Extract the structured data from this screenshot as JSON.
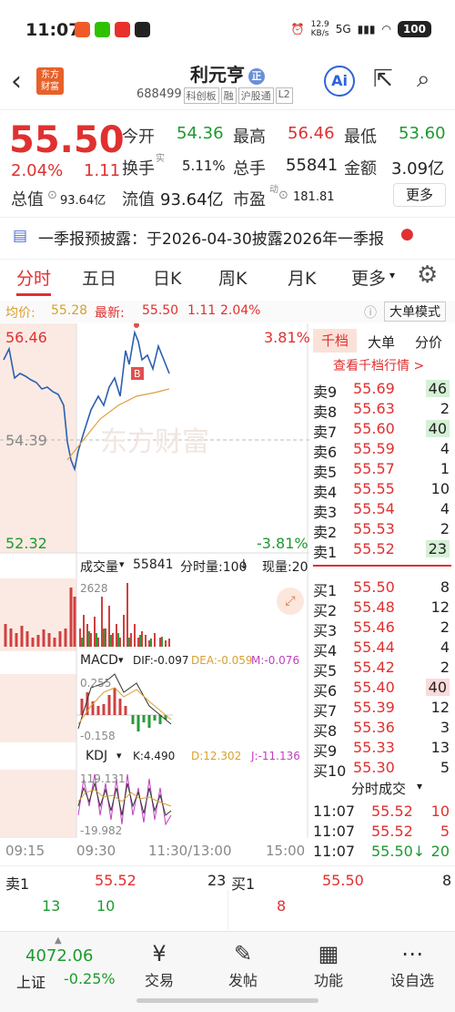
{
  "status": {
    "time": "11:07",
    "speed": "12.9\nKB/s",
    "net": "5G",
    "battery": "100"
  },
  "header": {
    "logo_line1": "东方",
    "logo_line2": "财富",
    "name": "利元亨",
    "name_badge": "正",
    "code": "688499",
    "tags": [
      "科创板",
      "融",
      "沪股通",
      "L2"
    ]
  },
  "quote": {
    "price": "55.50",
    "pct": "2.04%",
    "chg": "1.11",
    "open_lbl": "今开",
    "open": "54.36",
    "high_lbl": "最高",
    "high": "56.46",
    "low_lbl": "最低",
    "low": "53.60",
    "turn_lbl": "换手",
    "turn_sup": "实",
    "turn": "5.11%",
    "vol_lbl": "总手",
    "vol": "55841",
    "amt_lbl": "金额",
    "amt": "3.09亿",
    "cap_lbl": "总值",
    "cap": "93.64亿",
    "float_lbl": "流值",
    "float": "93.64亿",
    "pe_lbl": "市盈",
    "pe_sup": "动",
    "pe": "181.81",
    "more": "更多"
  },
  "notice": {
    "text": "一季报预披露：于2026-04-30披露2026年一季报"
  },
  "tabs": [
    "分时",
    "五日",
    "日K",
    "周K",
    "月K",
    "更多"
  ],
  "pricebar": {
    "avg_lbl": "均价:",
    "avg": "55.28",
    "last_lbl": "最新:",
    "last": "55.50",
    "chg": "1.11",
    "pct": "2.04%",
    "mode": "大单模式"
  },
  "chart": {
    "top": "56.46",
    "mid": "54.39",
    "bottom": "52.32",
    "top_pct": "3.81%",
    "bottom_pct": "-3.81%",
    "watermark": "东方财富",
    "vol_lbl": "成交量",
    "vol_val": "55841",
    "vol_max": "2628",
    "vol_unit": "分时量:100",
    "vol_now": "现量:20",
    "macd_lbl": "MACD",
    "dif": "DIF:-0.097",
    "dea": "DEA:-0.059",
    "m": "M:-0.076",
    "macd_hi": "0.255",
    "macd_lo": "-0.158",
    "kdj_lbl": "KDJ",
    "k": "K:4.490",
    "d": "D:12.302",
    "j": "J:-11.136",
    "kdj_hi": "119.131",
    "kdj_lo": "-19.982",
    "times": [
      "09:15",
      "09:30",
      "11:30/13:00",
      "15:00"
    ]
  },
  "orderbook": {
    "tabs": [
      "千档",
      "大单",
      "分价"
    ],
    "link": "查看千档行情 >",
    "sells": [
      [
        "卖9",
        "55.69",
        "46"
      ],
      [
        "卖8",
        "55.63",
        "2"
      ],
      [
        "卖7",
        "55.60",
        "40"
      ],
      [
        "卖6",
        "55.59",
        "4"
      ],
      [
        "卖5",
        "55.57",
        "1"
      ],
      [
        "卖4",
        "55.55",
        "10"
      ],
      [
        "卖3",
        "55.54",
        "4"
      ],
      [
        "卖2",
        "55.53",
        "2"
      ],
      [
        "卖1",
        "55.52",
        "23"
      ]
    ],
    "buys": [
      [
        "买1",
        "55.50",
        "8"
      ],
      [
        "买2",
        "55.48",
        "12"
      ],
      [
        "买3",
        "55.46",
        "2"
      ],
      [
        "买4",
        "55.44",
        "4"
      ],
      [
        "买5",
        "55.42",
        "2"
      ],
      [
        "买6",
        "55.40",
        "40"
      ],
      [
        "买7",
        "55.39",
        "12"
      ],
      [
        "买8",
        "55.36",
        "3"
      ],
      [
        "买9",
        "55.33",
        "13"
      ],
      [
        "买10",
        "55.30",
        "5"
      ]
    ],
    "trades_title": "分时成交",
    "trades": [
      [
        "11:07",
        "55.52",
        "10"
      ],
      [
        "11:07",
        "55.52",
        "5"
      ],
      [
        "11:07",
        "55.50↓",
        "20"
      ]
    ]
  },
  "bottom": {
    "sell_lbl": "卖1",
    "sell_px": "55.52",
    "sell_qty": "23",
    "buy_lbl": "买1",
    "buy_px": "55.50",
    "buy_qty": "8",
    "a": "13",
    "b": "10",
    "c": "8"
  },
  "nav": {
    "index": "4072.06",
    "index_name": "上证",
    "index_pct": "-0.25%",
    "items": [
      "交易",
      "发帖",
      "功能",
      "设自选"
    ]
  }
}
